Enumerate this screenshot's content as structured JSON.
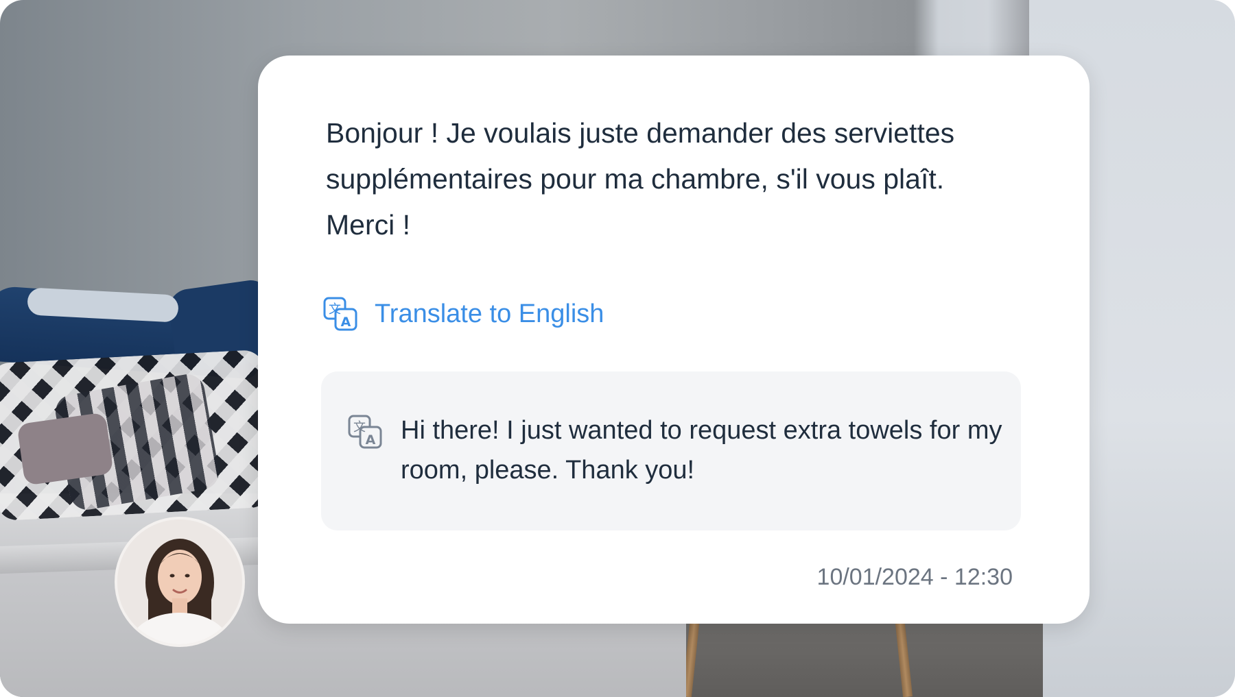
{
  "message": {
    "original_text": "Bonjour ! Je voulais juste demander des serviettes supplémentaires pour ma chambre, s'il vous plaît. Merci !",
    "translate_label": "Translate to English",
    "translation_text": "Hi there! I just wanted to request extra towels for my room, please. Thank you!",
    "timestamp": "10/01/2024 - 12:30"
  },
  "icons": {
    "translate": "translate-icon",
    "cursor": "mouse-pointer-icon",
    "avatar": "user-avatar"
  },
  "colors": {
    "accent": "#3a8ee6",
    "text": "#1f2d3d",
    "muted": "#6b7480",
    "translation_bg": "#f4f5f7",
    "card_bg": "#ffffff"
  }
}
